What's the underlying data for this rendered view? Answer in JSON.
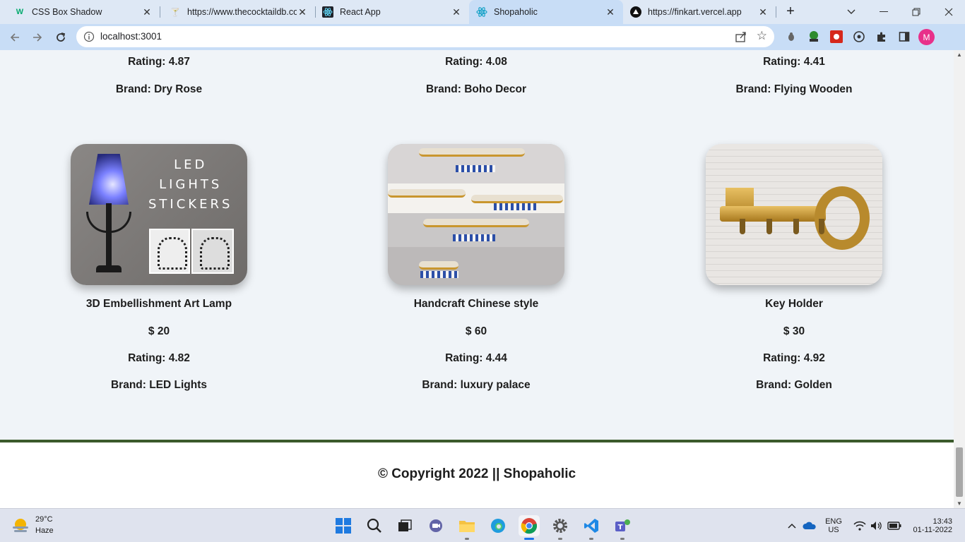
{
  "browser": {
    "tabs": [
      {
        "title": "CSS Box Shadow",
        "icon": "w3schools-icon"
      },
      {
        "title": "https://www.thecocktaildb.co",
        "icon": "cocktail-icon"
      },
      {
        "title": "React App",
        "icon": "react-icon"
      },
      {
        "title": "Shopaholic",
        "icon": "react-icon",
        "active": true
      },
      {
        "title": "https://finkart.vercel.app",
        "icon": "vercel-icon"
      }
    ],
    "url": "localhost:3001",
    "profile_initial": "M"
  },
  "products_top": [
    {
      "rating": "Rating: 4.87",
      "brand": "Brand: Dry Rose"
    },
    {
      "rating": "Rating: 4.08",
      "brand": "Brand: Boho Decor"
    },
    {
      "rating": "Rating: 4.41",
      "brand": "Brand: Flying Wooden"
    }
  ],
  "products": [
    {
      "name": "3D Embellishment Art Lamp",
      "price": "$ 20",
      "rating": "Rating: 4.82",
      "brand": "Brand: LED Lights",
      "image_text": [
        "LED",
        "LIGHTS",
        "STICKERS"
      ]
    },
    {
      "name": "Handcraft Chinese style",
      "price": "$ 60",
      "rating": "Rating: 4.44",
      "brand": "Brand: luxury palace"
    },
    {
      "name": "Key Holder",
      "price": "$ 30",
      "rating": "Rating: 4.92",
      "brand": "Brand: Golden"
    }
  ],
  "footer": {
    "copyright": "© Copyright 2022 || Shopaholic"
  },
  "taskbar": {
    "weather_temp": "29°C",
    "weather_cond": "Haze",
    "lang": "ENG",
    "region": "US",
    "time": "13:43",
    "date": "01-11-2022"
  },
  "colors": {
    "page_bg": "#f0f4f8",
    "footer_border": "#3b5a2c",
    "tab_active": "#c8ddf6"
  }
}
